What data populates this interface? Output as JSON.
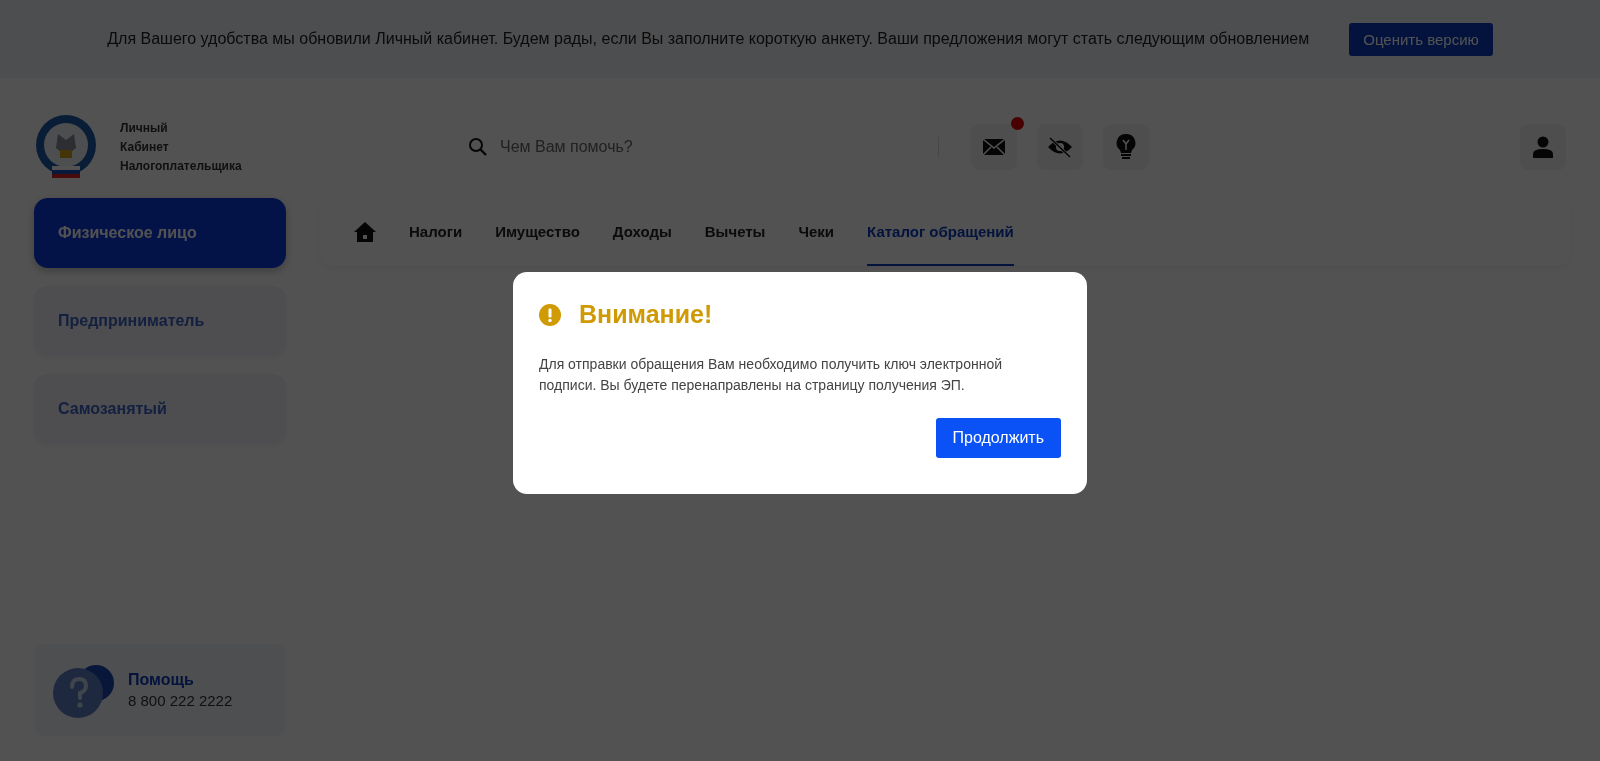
{
  "banner": {
    "text": "Для Вашего удобства мы обновили Личный кабинет. Будем рады, если Вы заполните короткую анкету. Ваши предложения могут стать следующим обновлением",
    "button": "Оценить версию"
  },
  "logo": {
    "lines": [
      "Личный",
      "Кабинет",
      "Налогоплательщика"
    ]
  },
  "search": {
    "placeholder": "Чем Вам помочь?"
  },
  "header_icons": [
    {
      "kind": "mail",
      "badge": true
    },
    {
      "kind": "eye-off",
      "badge": false
    },
    {
      "kind": "bulb",
      "badge": false
    }
  ],
  "sidebar": {
    "items": [
      {
        "label": "Физическое лицо",
        "selected": true
      },
      {
        "label": "Предприниматель",
        "selected": false
      },
      {
        "label": "Самозанятый",
        "selected": false
      }
    ]
  },
  "help": {
    "title": "Помощь",
    "phone": "8 800 222 2222"
  },
  "tabs": [
    {
      "label": "Налоги",
      "selected": false
    },
    {
      "label": "Имущество",
      "selected": false
    },
    {
      "label": "Доходы",
      "selected": false
    },
    {
      "label": "Вычеты",
      "selected": false
    },
    {
      "label": "Чеки",
      "selected": false
    },
    {
      "label": "Каталог обращений",
      "selected": true
    }
  ],
  "dialog": {
    "title": "Внимание!",
    "text": "Для отправки обращения Вам необходимо получить ключ электронной подписи. Вы будете перенаправлены на страницу получения ЭП.",
    "button": "Продолжить"
  }
}
